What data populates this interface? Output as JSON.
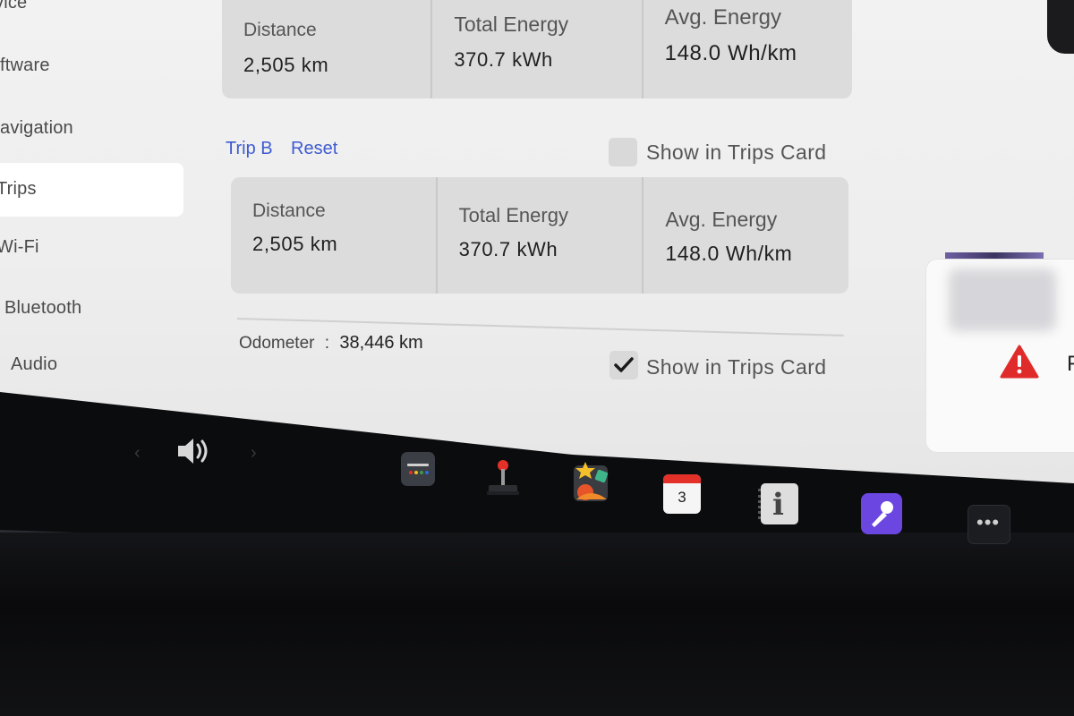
{
  "sidebar": {
    "items": [
      {
        "label": "vice"
      },
      {
        "label": "ftware"
      },
      {
        "label": "avigation"
      },
      {
        "label": "Trips"
      },
      {
        "label": "Wi-Fi"
      },
      {
        "label": "Bluetooth"
      },
      {
        "label": "Audio"
      }
    ],
    "active_index": 3
  },
  "trip_a": {
    "stats": [
      {
        "label": "Distance",
        "value": "2,505 km"
      },
      {
        "label": "Total Energy",
        "value": "370.7 kWh"
      },
      {
        "label": "Avg. Energy",
        "value": "148.0 Wh/km"
      }
    ]
  },
  "trip_b": {
    "title": "Trip B",
    "reset_label": "Reset",
    "show_in_trips_card": {
      "label": "Show in Trips Card",
      "checked": false
    },
    "stats": [
      {
        "label": "Distance",
        "value": "2,505 km"
      },
      {
        "label": "Total Energy",
        "value": "370.7 kWh"
      },
      {
        "label": "Avg. Energy",
        "value": "148.0 Wh/km"
      }
    ]
  },
  "odometer": {
    "label": "Odometer",
    "separator": ":",
    "value": "38,446 km",
    "show_in_trips_card": {
      "label": "Show in Trips Card",
      "checked": true
    }
  },
  "alert": {
    "icon": "warning-triangle-icon",
    "text": "F",
    "color": "#e02b2b"
  },
  "taskbar": {
    "volume_icon": "volume-icon",
    "apps": [
      {
        "icon": "toybox-icon"
      },
      {
        "icon": "arcade-joystick-icon"
      },
      {
        "icon": "theater-icon"
      },
      {
        "icon": "calendar-icon",
        "text": "3"
      },
      {
        "icon": "manual-info-icon",
        "text": "i"
      },
      {
        "icon": "karaoke-mic-icon"
      },
      {
        "icon": "more-dots-icon"
      }
    ]
  },
  "colors": {
    "accent_link": "#3f5bd1",
    "karaoke": "#6b46e0",
    "calendar_red": "#e3312a"
  }
}
